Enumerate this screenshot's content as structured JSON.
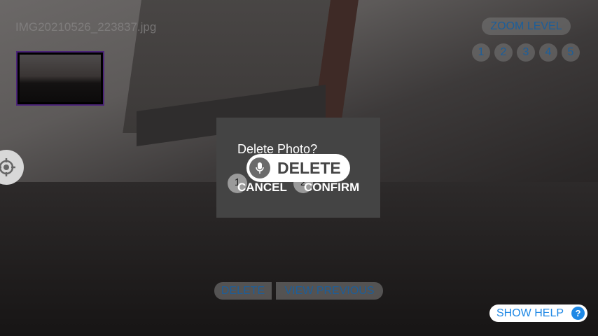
{
  "filename": "IMG20210526_223837.jpg",
  "zoom": {
    "label": "ZOOM LEVEL",
    "levels": [
      "1",
      "2",
      "3",
      "4",
      "5"
    ]
  },
  "dialog": {
    "title": "Delete Photo?",
    "cancel": "CANCEL",
    "confirm": "CONFIRM",
    "cancel_num": "1",
    "confirm_num": "2"
  },
  "voice": {
    "command": "DELETE"
  },
  "bottom": {
    "delete": "DELETE",
    "view_previous": "VIEW PREVIOUS"
  },
  "help": {
    "label": "SHOW HELP",
    "icon": "?"
  }
}
